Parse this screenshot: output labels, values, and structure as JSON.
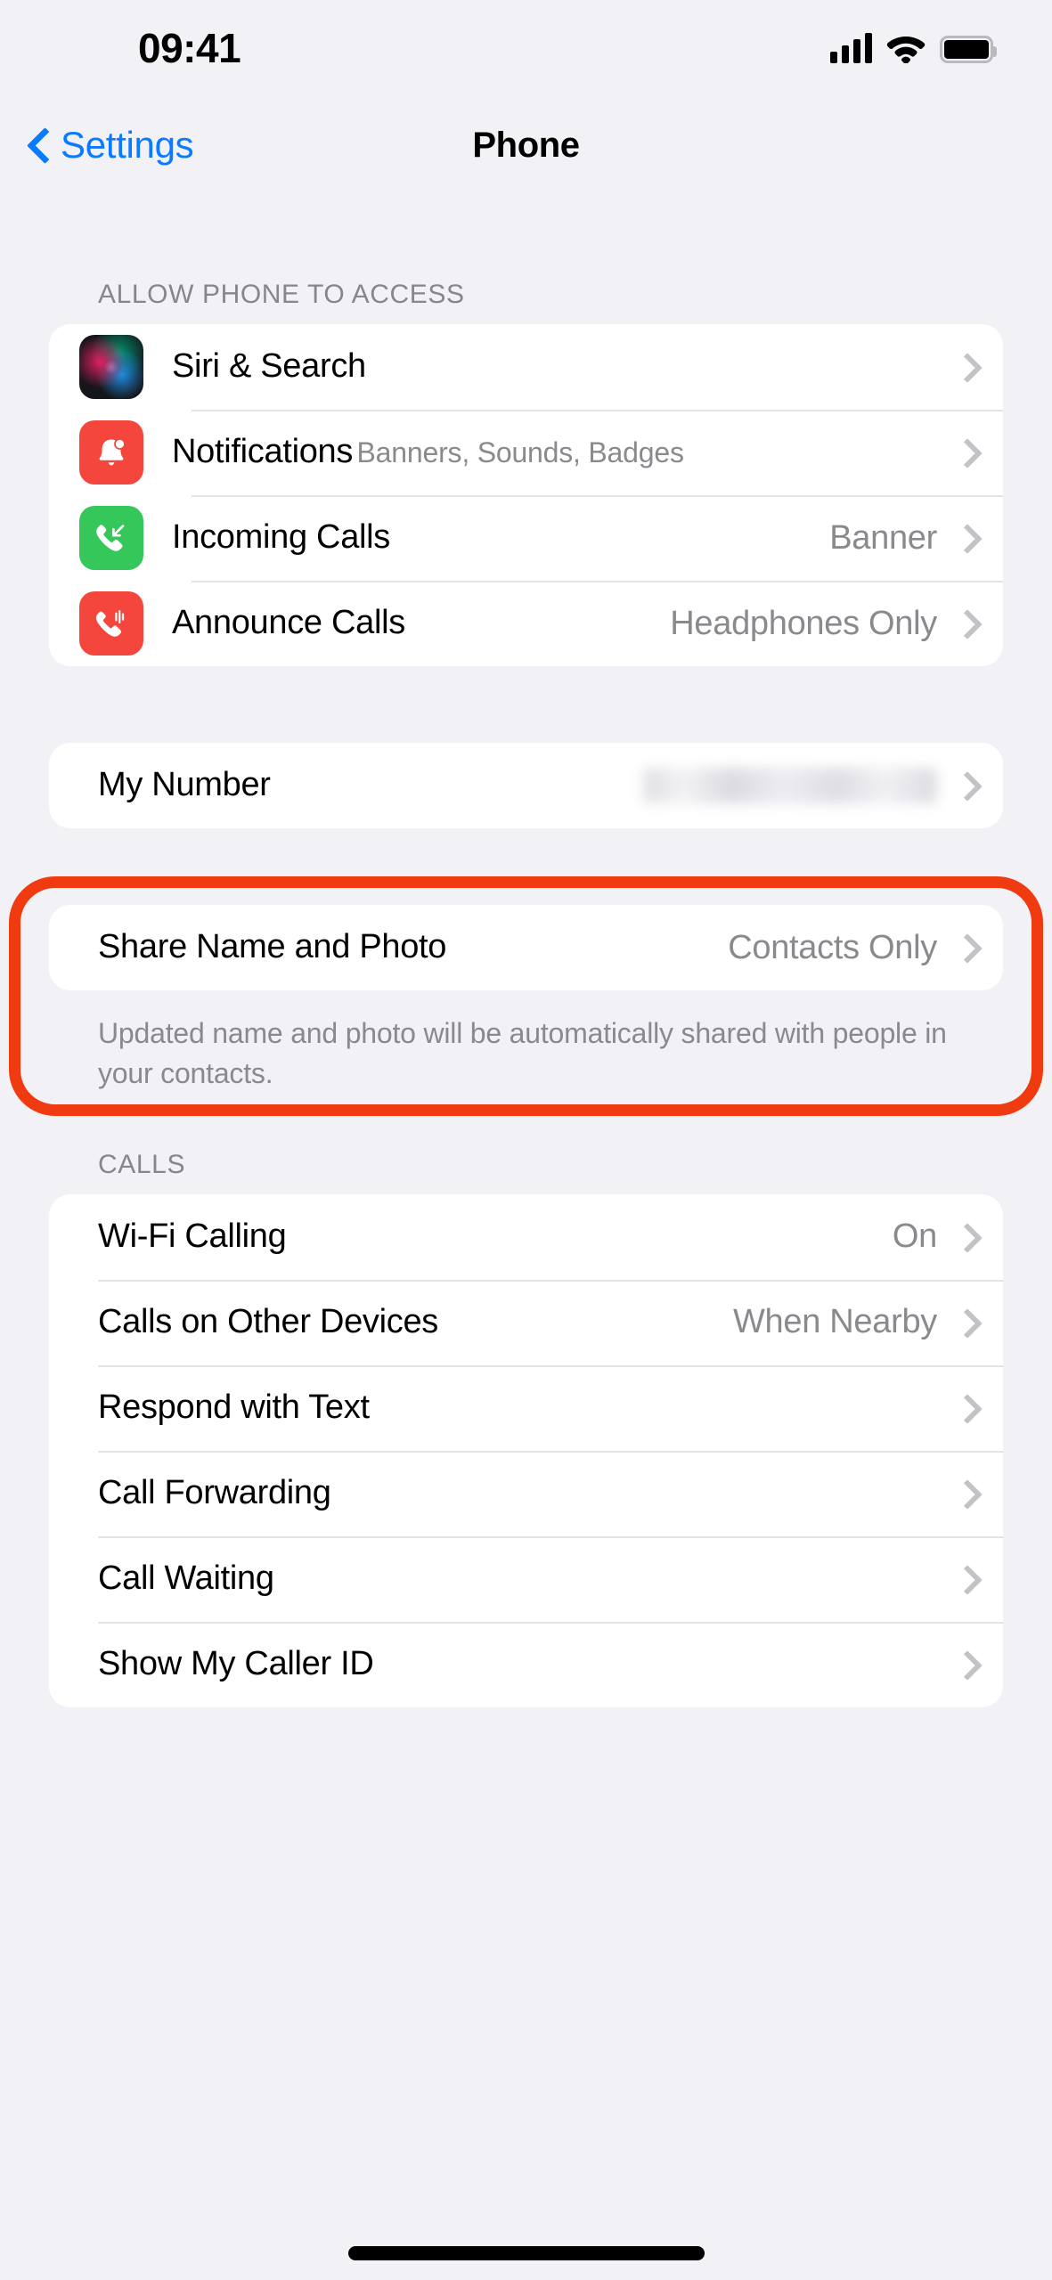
{
  "status_bar": {
    "time": "09:41",
    "signal_icon": "cellular-signal-icon",
    "wifi_icon": "wifi-icon",
    "battery_icon": "battery-icon"
  },
  "nav": {
    "back_label": "Settings",
    "back_icon": "chevron-left-icon",
    "title": "Phone"
  },
  "sections": [
    {
      "header": "ALLOW PHONE TO ACCESS",
      "rows": [
        {
          "icon": "siri-icon",
          "title": "Siri & Search",
          "subtitle": "",
          "value": ""
        },
        {
          "icon": "notifications-bell-icon",
          "title": "Notifications",
          "subtitle": "Banners, Sounds, Badges",
          "value": ""
        },
        {
          "icon": "incoming-call-icon",
          "title": "Incoming Calls",
          "subtitle": "",
          "value": "Banner"
        },
        {
          "icon": "announce-calls-icon",
          "title": "Announce Calls",
          "subtitle": "",
          "value": "Headphones Only"
        }
      ]
    },
    {
      "header": "",
      "rows": [
        {
          "icon": "",
          "title": "My Number",
          "subtitle": "",
          "value": "",
          "redacted": true
        }
      ]
    },
    {
      "header": "",
      "highlighted": true,
      "rows": [
        {
          "icon": "",
          "title": "Share Name and Photo",
          "subtitle": "",
          "value": "Contacts Only"
        }
      ],
      "footer": "Updated name and photo will be automatically shared with people in your contacts."
    },
    {
      "header": "CALLS",
      "rows": [
        {
          "icon": "",
          "title": "Wi-Fi Calling",
          "subtitle": "",
          "value": "On"
        },
        {
          "icon": "",
          "title": "Calls on Other Devices",
          "subtitle": "",
          "value": "When Nearby"
        },
        {
          "icon": "",
          "title": "Respond with Text",
          "subtitle": "",
          "value": ""
        },
        {
          "icon": "",
          "title": "Call Forwarding",
          "subtitle": "",
          "value": ""
        },
        {
          "icon": "",
          "title": "Call Waiting",
          "subtitle": "",
          "value": ""
        },
        {
          "icon": "",
          "title": "Show My Caller ID",
          "subtitle": "",
          "value": ""
        }
      ]
    }
  ],
  "colors": {
    "background": "#F1F1F6",
    "card": "#FFFFFF",
    "accent_blue": "#0A7AFF",
    "highlight_red": "#F03A10",
    "secondary_text": "#8A8A8E",
    "notifications_icon": "#F4463C",
    "incoming_calls_icon": "#35C759"
  },
  "home_indicator": "home-indicator"
}
